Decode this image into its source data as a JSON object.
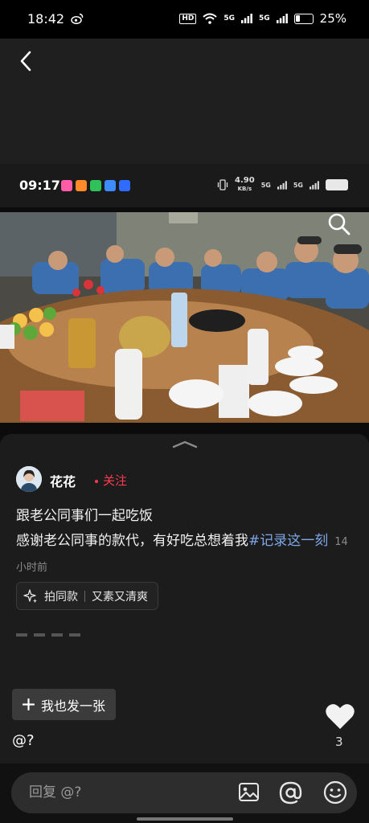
{
  "status_bar": {
    "time": "18:42",
    "hd": "HD",
    "signal_1": "5G",
    "signal_2": "5G",
    "battery": "25%"
  },
  "inner_status": {
    "time": "09:17",
    "speed": "4.90",
    "speed_unit": "KB/s",
    "signal_1": "5G",
    "signal_2": "5G"
  },
  "post": {
    "username": "花花",
    "follow_label": "关注",
    "text_line1": "跟老公同事们一起吃饭",
    "text_line2": "感谢老公同事的款代，有好吃总想着我",
    "hashtag": "#记录这一刻",
    "time_ago": "14小时前",
    "template_label": "拍同款",
    "template_name": "又素又清爽"
  },
  "actions": {
    "post_button": "我也发一张",
    "like_count": "3",
    "mention": "@?"
  },
  "reply": {
    "placeholder": "回复 @?"
  },
  "colors": {
    "accent_red": "#ff3b52",
    "hashtag_blue": "#7ea7e8"
  },
  "icons": [
    "back-icon",
    "search-icon",
    "sparkle-icon",
    "plus-icon",
    "heart-icon",
    "image-icon",
    "at-icon",
    "emoji-icon",
    "weibo-icon",
    "wifi-icon"
  ]
}
